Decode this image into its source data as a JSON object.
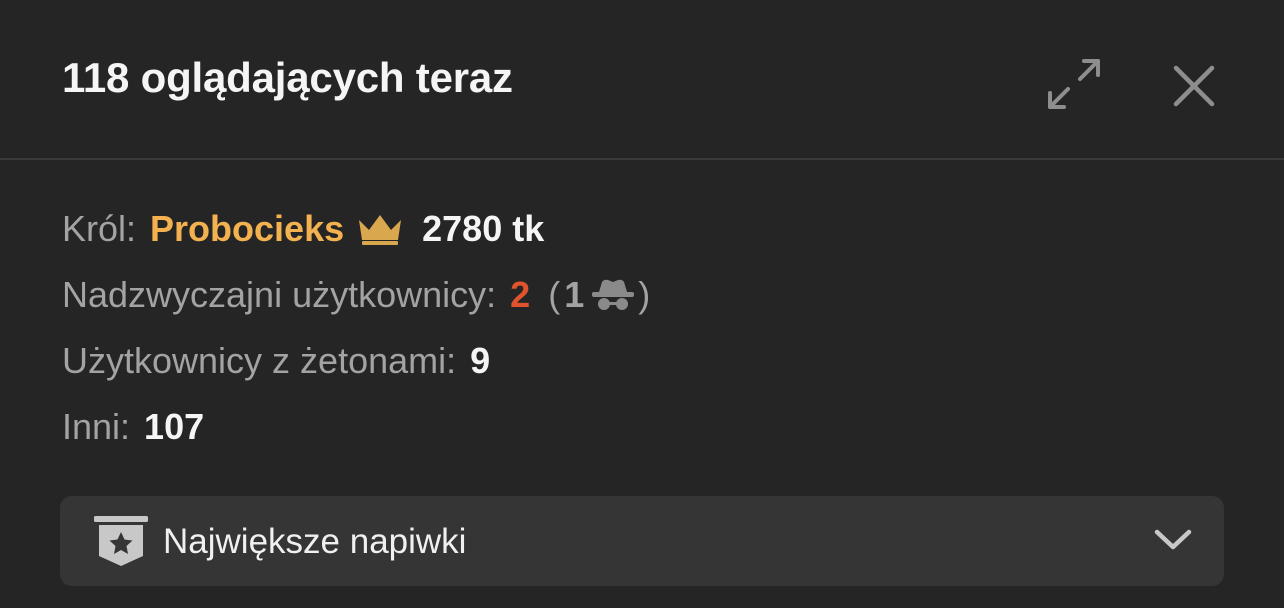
{
  "header": {
    "title": "118 oglądających teraz",
    "expand_icon": "expand-arrows-icon",
    "close_icon": "close-icon"
  },
  "stats": {
    "king": {
      "label": "Król:",
      "name": "Probocieks",
      "icon": "crown-icon",
      "tokens": "2780 tk"
    },
    "premium": {
      "label": "Nadzwyczajni użytkownicy:",
      "count": "2",
      "paren_open": "(",
      "anonymous_count": "1",
      "anonymous_icon": "incognito-spy-icon",
      "paren_close": ")"
    },
    "token_users": {
      "label": "Użytkownicy z żetonami:",
      "count": "9"
    },
    "others": {
      "label": "Inni:",
      "count": "107"
    }
  },
  "dropdown": {
    "label": "Największe napiwki",
    "icon": "star-badge-icon",
    "chevron_icon": "chevron-down-icon"
  },
  "colors": {
    "background": "#252525",
    "accent_gold": "#f3b24f",
    "accent_red": "#e0532c",
    "muted_text": "#a3a3a3",
    "primary_text": "#f5f5f5",
    "dropdown_bg": "#353535"
  }
}
